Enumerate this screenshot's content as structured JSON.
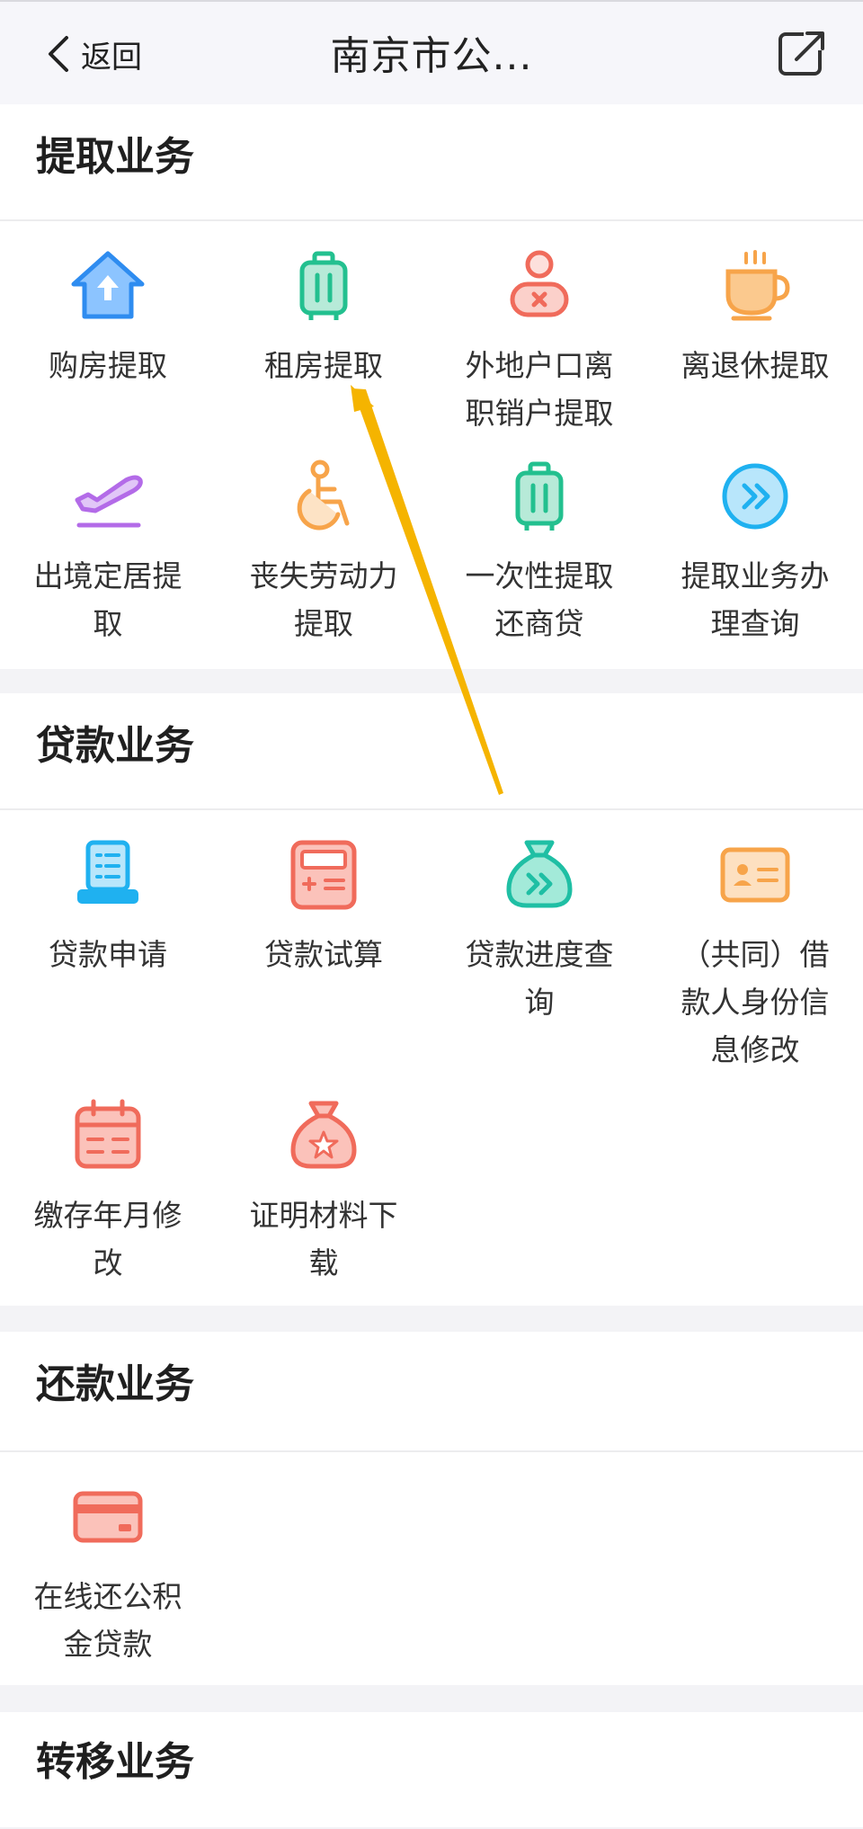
{
  "nav": {
    "back_label": "返回",
    "title": "南京市公..."
  },
  "sections": {
    "withdraw": {
      "title": "提取业务",
      "items": [
        {
          "label": "购房提取",
          "icon": "house-upload-icon"
        },
        {
          "label": "租房提取",
          "icon": "suitcase-icon"
        },
        {
          "label": "外地户口离职销户提取",
          "icon": "person-cancel-icon"
        },
        {
          "label": "离退休提取",
          "icon": "coffee-cup-icon"
        },
        {
          "label": "出境定居提取",
          "icon": "airplane-takeoff-icon"
        },
        {
          "label": "丧失劳动力提取",
          "icon": "wheelchair-icon"
        },
        {
          "label": "一次性提取还商贷",
          "icon": "suitcase-icon"
        },
        {
          "label": "提取业务办理查询",
          "icon": "fast-forward-circle-icon"
        }
      ]
    },
    "loan": {
      "title": "贷款业务",
      "items": [
        {
          "label": "贷款申请",
          "icon": "document-stand-icon"
        },
        {
          "label": "贷款试算",
          "icon": "calculator-icon"
        },
        {
          "label": "贷款进度查询",
          "icon": "money-bag-forward-icon"
        },
        {
          "label": "（共同）借款人身份信息修改",
          "icon": "id-card-icon"
        },
        {
          "label": "缴存年月修改",
          "icon": "calendar-icon"
        },
        {
          "label": "证明材料下载",
          "icon": "money-bag-star-icon"
        }
      ]
    },
    "repay": {
      "title": "还款业务",
      "items": [
        {
          "label": "在线还公积金贷款",
          "icon": "bank-card-icon"
        }
      ]
    },
    "transfer": {
      "title": "转移业务"
    }
  },
  "colors": {
    "accent_arrow": "#f5b400"
  }
}
